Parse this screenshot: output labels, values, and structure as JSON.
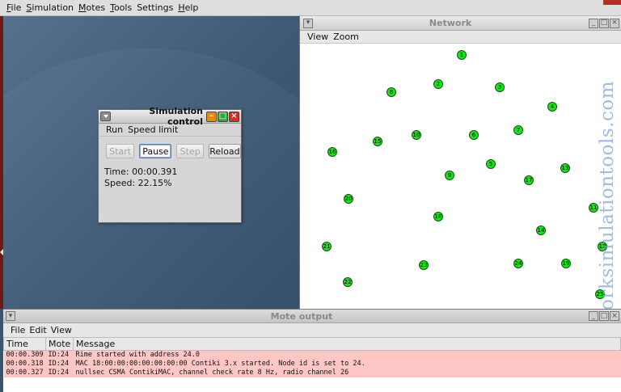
{
  "menubar": {
    "items": [
      {
        "label": "File",
        "ul": "F",
        "rest": "ile"
      },
      {
        "label": "Simulation",
        "ul": "S",
        "rest": "imulation"
      },
      {
        "label": "Motes",
        "ul": "M",
        "rest": "otes"
      },
      {
        "label": "Tools",
        "ul": "T",
        "rest": "ools"
      },
      {
        "label": "Settings",
        "ul": "",
        "rest": "Settings"
      },
      {
        "label": "Help",
        "ul": "H",
        "rest": "elp"
      }
    ]
  },
  "simulation_control": {
    "title": "Simulation control",
    "menu": [
      "Run",
      "Speed limit"
    ],
    "buttons": {
      "start": "Start",
      "pause": "Pause",
      "step": "Step",
      "reload": "Reload"
    },
    "time": "Time: 00:00.391",
    "speed": "Speed: 22.15%"
  },
  "network": {
    "title": "Network",
    "menu": [
      "View",
      "Zoom"
    ],
    "watermark": "networksimulationtools.com",
    "node_color": "#1fe01f",
    "nodes": [
      {
        "id": "1"
      },
      {
        "id": "2"
      },
      {
        "id": "3"
      },
      {
        "id": "4"
      },
      {
        "id": "5"
      },
      {
        "id": "6"
      },
      {
        "id": "7"
      },
      {
        "id": "8"
      },
      {
        "id": "9"
      },
      {
        "id": "10"
      },
      {
        "id": "11"
      },
      {
        "id": "12"
      },
      {
        "id": "13"
      },
      {
        "id": "14"
      },
      {
        "id": "15"
      },
      {
        "id": "16"
      },
      {
        "id": "17"
      },
      {
        "id": "18"
      },
      {
        "id": "19"
      },
      {
        "id": "20"
      },
      {
        "id": "21"
      },
      {
        "id": "22"
      },
      {
        "id": "23"
      },
      {
        "id": "24"
      },
      {
        "id": "25"
      }
    ]
  },
  "mote_output": {
    "title": "Mote output",
    "menu": [
      "File",
      "Edit",
      "View"
    ],
    "columns": [
      "Time",
      "Mote",
      "Message"
    ],
    "row_color": "#ffc6c6",
    "rows": [
      {
        "time": "00:00.309",
        "mote": "ID:24",
        "message": "Rime started with address 24.0"
      },
      {
        "time": "00:00.318",
        "mote": "ID:24",
        "message": "MAC 18:00:00:00:00:00:00:00 Contiki 3.x started. Node id is set to 24."
      },
      {
        "time": "00:00.327",
        "mote": "ID:24",
        "message": "nullsec CSMA ContikiMAC, channel check rate 8 Hz, radio channel 26"
      }
    ]
  }
}
